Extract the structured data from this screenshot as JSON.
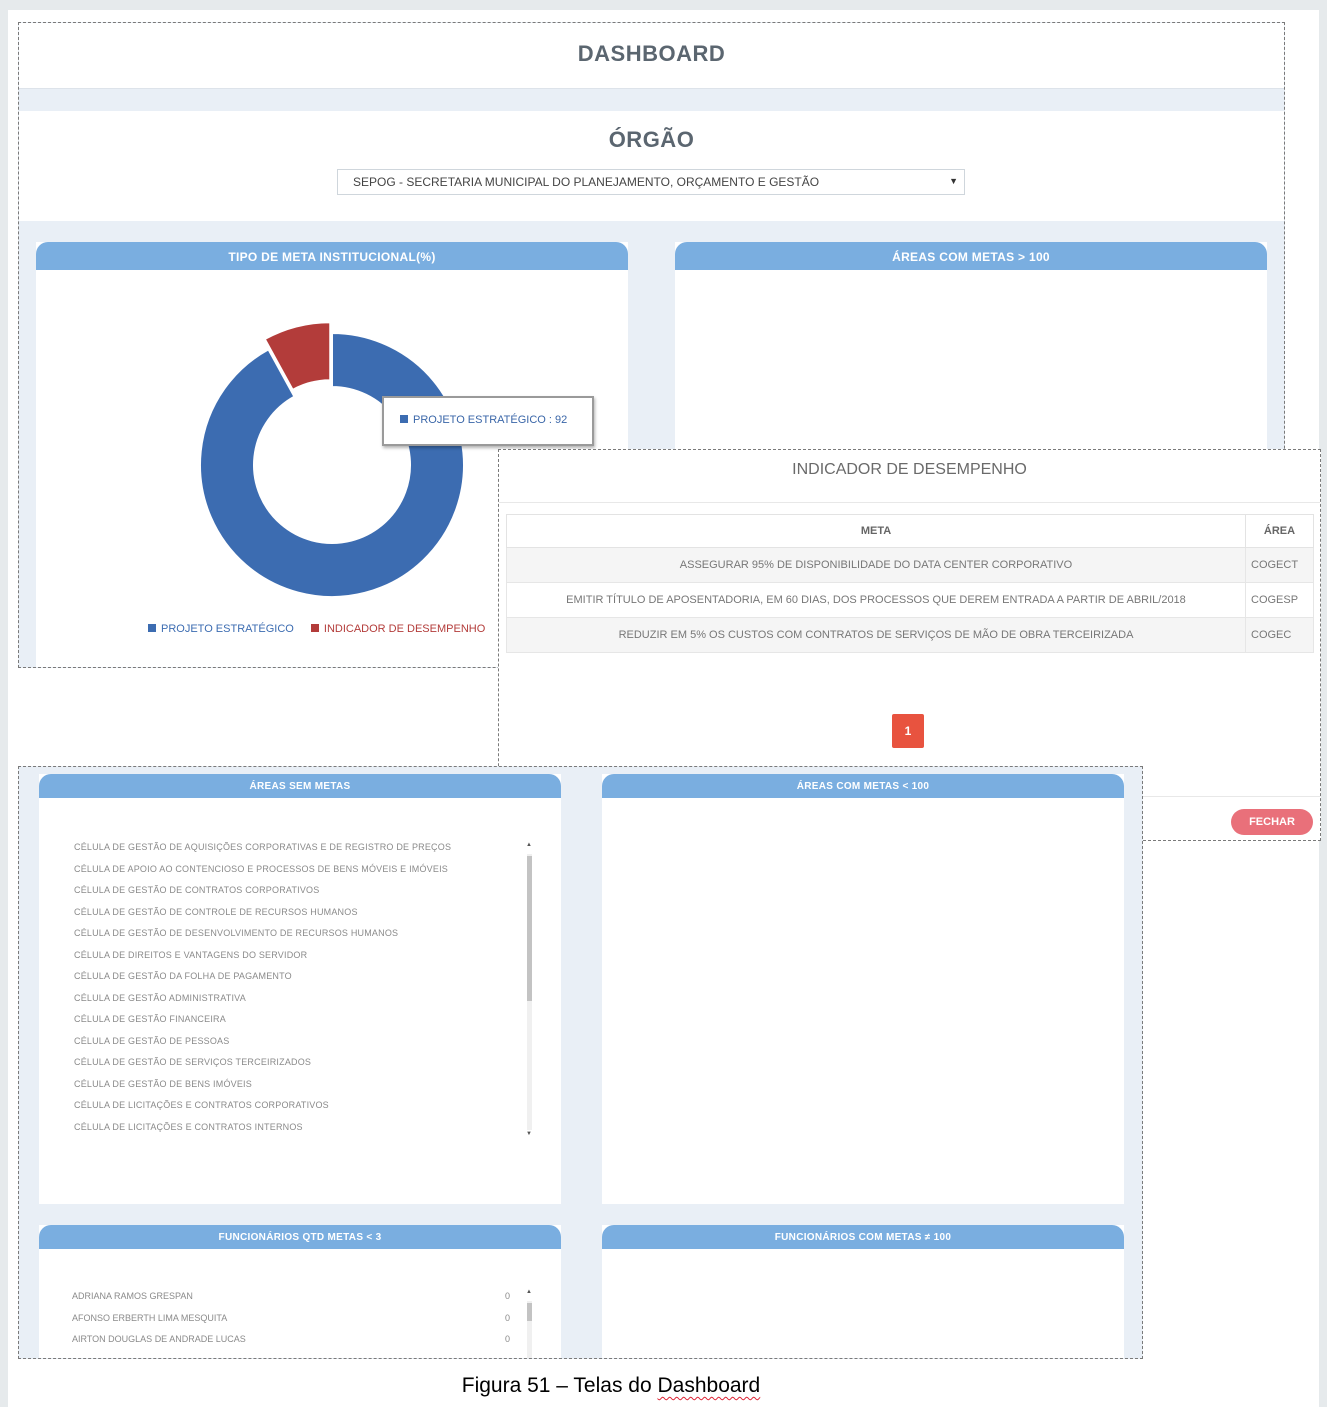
{
  "colors": {
    "panel_header": "#7aaee0",
    "series_blue": "#3c6cb1",
    "series_red": "#b33c3a",
    "page_button": "#e8533f",
    "close_button": "#e9707a"
  },
  "screen1": {
    "title": "DASHBOARD",
    "org_label": "ÓRGÃO",
    "org_select_value": "SEPOG - SECRETARIA MUNICIPAL DO PLANEJAMENTO, ORÇAMENTO E GESTÃO",
    "panel_left_title": "TIPO DE META INSTITUCIONAL(%)",
    "panel_right_title": "ÁREAS COM METAS > 100",
    "tooltip": "PROJETO ESTRATÉGICO : 92"
  },
  "chart_data": {
    "type": "pie",
    "categories": [
      "PROJETO ESTRATÉGICO",
      "INDICADOR DE DESEMPENHO"
    ],
    "values": [
      92,
      8
    ],
    "colors": [
      "#3c6cb1",
      "#b33c3a"
    ],
    "legend": "bottom"
  },
  "modal": {
    "title": "INDICADOR DE DESEMPENHO",
    "columns": [
      "META",
      "ÁREA"
    ],
    "rows": [
      {
        "meta": "ASSEGURAR 95% DE DISPONIBILIDADE DO DATA CENTER CORPORATIVO",
        "area": "COGECT"
      },
      {
        "meta": "EMITIR TÍTULO DE APOSENTADORIA, EM 60 DIAS, DOS PROCESSOS QUE DEREM ENTRADA A PARTIR DE ABRIL/2018",
        "area": "COGESP"
      },
      {
        "meta": "REDUZIR EM 5% OS CUSTOS COM CONTRATOS DE SERVIÇOS DE MÃO DE OBRA TERCEIRIZADA",
        "area": "COGEC"
      }
    ],
    "page": "1",
    "close_label": "FECHAR"
  },
  "screen2": {
    "panel_areas_sem_metas": "ÁREAS SEM METAS",
    "panel_areas_menor_100": "ÁREAS COM METAS < 100",
    "panel_func_qtd": "FUNCIONÁRIOS QTD METAS < 3",
    "panel_func_100": "FUNCIONÁRIOS COM METAS ≠ 100",
    "areas_sem_metas": [
      "CÉLULA DE GESTÃO DE AQUISIÇÕES CORPORATIVAS E DE REGISTRO DE PREÇOS",
      "CÉLULA DE APOIO AO CONTENCIOSO E PROCESSOS DE BENS MÓVEIS E IMÓVEIS",
      "CÉLULA DE GESTÃO DE CONTRATOS CORPORATIVOS",
      "CÉLULA DE GESTÃO DE CONTROLE DE RECURSOS HUMANOS",
      "CÉLULA DE GESTÃO DE DESENVOLVIMENTO DE RECURSOS HUMANOS",
      "CÉLULA DE DIREITOS E VANTAGENS DO SERVIDOR",
      "CÉLULA DE GESTÃO DA FOLHA DE PAGAMENTO",
      "CÉLULA DE GESTÃO ADMINISTRATIVA",
      "CÉLULA DE GESTÃO FINANCEIRA",
      "CÉLULA DE GESTÃO DE PESSOAS",
      "CÉLULA DE GESTÃO DE SERVIÇOS TERCEIRIZADOS",
      "CÉLULA DE GESTÃO DE BENS IMÓVEIS",
      "CÉLULA DE LICITAÇÕES E CONTRATOS CORPORATIVOS",
      "CÉLULA DE LICITAÇÕES E CONTRATOS INTERNOS"
    ],
    "funcionarios": [
      {
        "name": "ADRIANA RAMOS GRESPAN",
        "count": "0"
      },
      {
        "name": "AFONSO ERBERTH LIMA MESQUITA",
        "count": "0"
      },
      {
        "name": "AIRTON DOUGLAS DE ANDRADE LUCAS",
        "count": "0"
      }
    ]
  },
  "caption": {
    "prefix": "Figura 51 – Telas do ",
    "word": "Dashboard"
  }
}
